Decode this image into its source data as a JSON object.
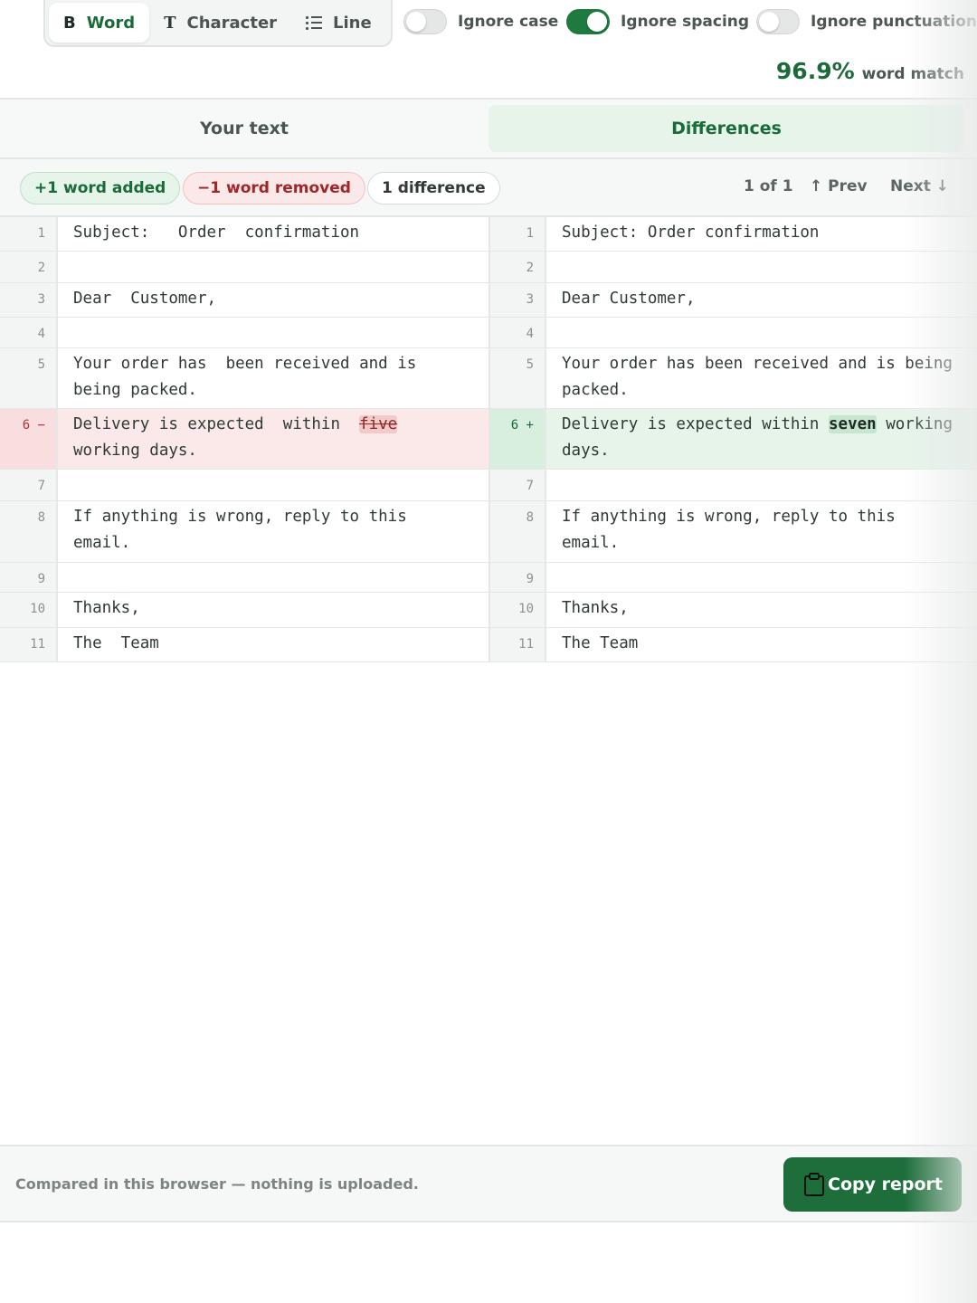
{
  "modes": [
    {
      "label": "Word",
      "active": true
    },
    {
      "label": "Character",
      "active": false
    },
    {
      "label": "Line",
      "active": false
    }
  ],
  "toggles": [
    {
      "label": "Ignore case",
      "on": false
    },
    {
      "label": "Ignore spacing",
      "on": true
    },
    {
      "label": "Ignore punctuation",
      "on": false
    }
  ],
  "match": {
    "value": "96.9%",
    "label": "word match"
  },
  "tabs": {
    "left": "Your text",
    "right": "Differences",
    "active": "right"
  },
  "summary": {
    "added": "+1 word added",
    "removed": "−1 word removed",
    "differences": "1 difference",
    "position": "1 of 1",
    "prev": "↑ Prev",
    "next": "Next ↓"
  },
  "diff": {
    "left": [
      {
        "n": "1",
        "text": "Subject:   Order  confirmation"
      },
      {
        "n": "2",
        "text": ""
      },
      {
        "n": "3",
        "text": "Dear  Customer,"
      },
      {
        "n": "4",
        "text": ""
      },
      {
        "n": "5",
        "text": "Your order has  been received and is\nbeing packed."
      },
      {
        "n": "6 −",
        "text_before": "Delivery is expected  within  ",
        "changed": "five",
        "text_after": "\nworking days.",
        "type": "removed"
      },
      {
        "n": "7",
        "text": ""
      },
      {
        "n": "8",
        "text": "If anything is wrong, reply to this\nemail."
      },
      {
        "n": "9",
        "text": ""
      },
      {
        "n": "10",
        "text": "Thanks,"
      },
      {
        "n": "11",
        "text": "The  Team"
      }
    ],
    "right": [
      {
        "n": "1",
        "text": "Subject: Order confirmation"
      },
      {
        "n": "2",
        "text": ""
      },
      {
        "n": "3",
        "text": "Dear Customer,"
      },
      {
        "n": "4",
        "text": ""
      },
      {
        "n": "5",
        "text": "Your order has been received and is being\npacked."
      },
      {
        "n": "6 +",
        "text_before": "Delivery is expected within ",
        "changed": "seven",
        "text_after": " working\ndays.",
        "type": "added"
      },
      {
        "n": "7",
        "text": ""
      },
      {
        "n": "8",
        "text": "If anything is wrong, reply to this\nemail."
      },
      {
        "n": "9",
        "text": ""
      },
      {
        "n": "10",
        "text": "Thanks,"
      },
      {
        "n": "11",
        "text": "The Team"
      }
    ]
  },
  "footer": {
    "note": "Compared in this browser — nothing is uploaded.",
    "copy_button": "Copy report"
  },
  "colors": {
    "accent": "#1e6e3c",
    "added_bg": "#e6f4ea",
    "removed_bg": "#fbe9e9",
    "removed_text": "#a32626"
  },
  "icons": {
    "word": "bold-b-icon",
    "character": "serif-t-icon",
    "line": "list-icon",
    "copy": "clipboard-icon"
  }
}
